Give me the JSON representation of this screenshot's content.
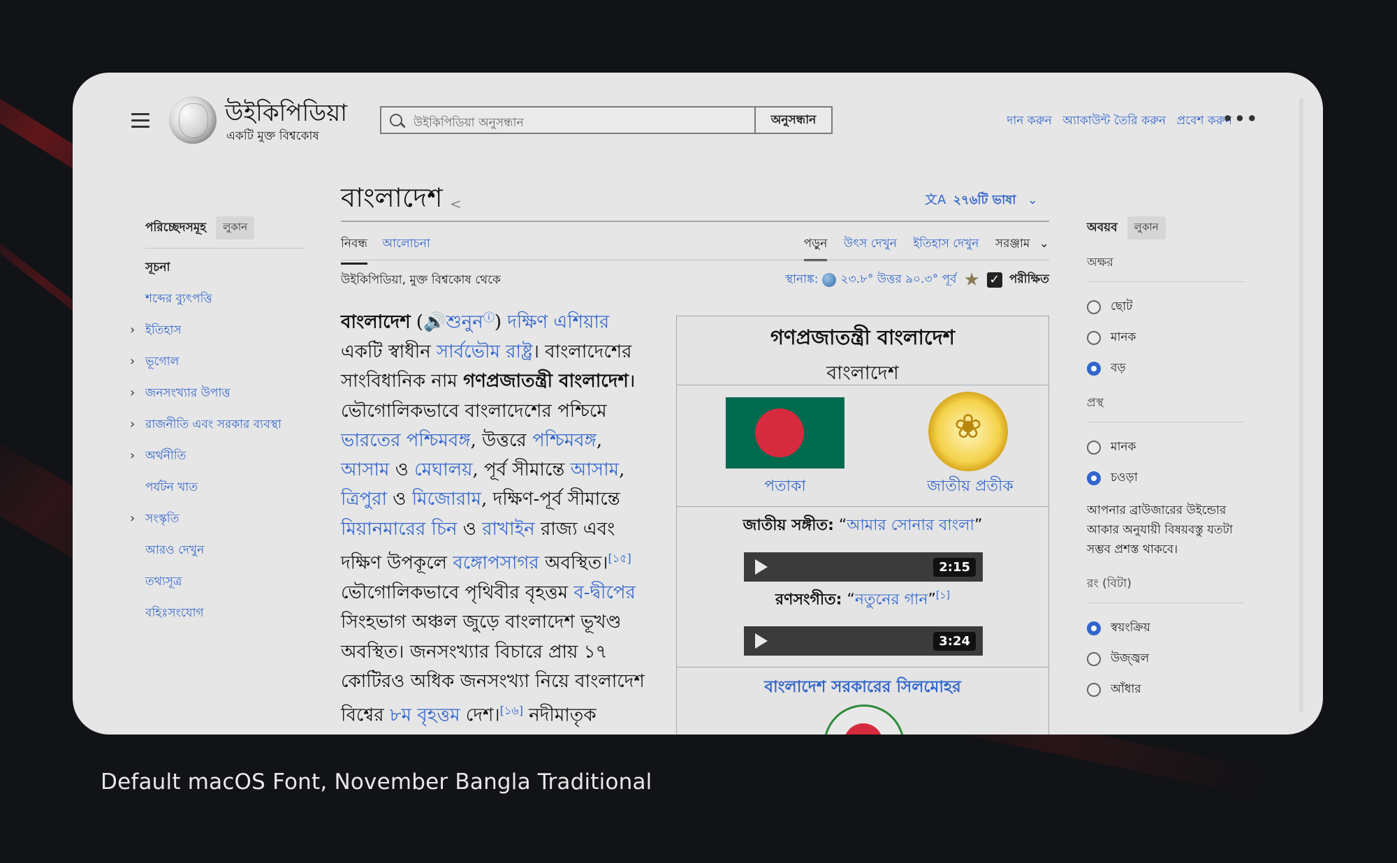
{
  "header": {
    "wordmark": "উইকিপিডিয়া",
    "tagline": "একটি মুক্ত বিশ্বকোষ",
    "search_placeholder": "উইকিপিডিয়া অনুসন্ধান",
    "search_button": "অনুসন্ধান",
    "user_links": [
      "দান করুন",
      "অ্যাকাউন্ট তৈরি করুন",
      "প্রবেশ করুন"
    ]
  },
  "toc": {
    "heading": "পরিচ্ছেদসমূহ",
    "hide_label": "লুকান",
    "items": [
      {
        "label": "সূচনা",
        "expandable": false
      },
      {
        "label": "শব্দের ব্যুৎপত্তি",
        "expandable": false
      },
      {
        "label": "ইতিহাস",
        "expandable": true
      },
      {
        "label": "ভূগোল",
        "expandable": true
      },
      {
        "label": "জনসংখ্যার উপাত্ত",
        "expandable": true
      },
      {
        "label": "রাজনীতি এবং সরকার ব্যবস্থা",
        "expandable": true
      },
      {
        "label": "অর্থনীতি",
        "expandable": true
      },
      {
        "label": "পর্যটন খাত",
        "expandable": false
      },
      {
        "label": "সংস্কৃতি",
        "expandable": true
      },
      {
        "label": "আরও দেখুন",
        "expandable": false
      },
      {
        "label": "তথ্যসূত্র",
        "expandable": false
      },
      {
        "label": "বহিঃসংযোগ",
        "expandable": false
      }
    ]
  },
  "article": {
    "title": "বাংলাদেশ",
    "languages": "২৭৬টি ভাষা",
    "tabs_left": [
      "নিবন্ধ",
      "আলোচনা"
    ],
    "tabs_right": [
      "পড়ুন",
      "উৎস দেখুন",
      "ইতিহাস দেখুন",
      "সরঞ্জাম"
    ],
    "from": "উইকিপিডিয়া, মুক্ত বিশ্বকোষ থেকে",
    "coord_label": "স্থানাঙ্ক:",
    "coord_value": "২৩.৮° উত্তর ৯০.৩° পূর্ব",
    "verified": "পরীক্ষিত",
    "body": {
      "l1_bold": "বাংলাদেশ",
      "l1_paren_open": " (",
      "l1_listen": "🔊শুনুন",
      "l1_info": "ⓘ",
      "l1_paren_close": ") ",
      "l1_link": "দক্ষিণ এশিয়ার",
      "l2_pre": "একটি স্বাধীন ",
      "l2_link": "সার্বভৌম রাষ্ট্র",
      "l2_post": "। বাংলাদেশের",
      "l3_pre": "সাংবিধানিক নাম ",
      "l3_bold": "গণপ্রজাতন্ত্রী বাংলাদেশ",
      "l3_post": "।",
      "l4": "ভৌগোলিকভাবে বাংলাদেশের পশ্চিমে",
      "l5_link1": "ভারতের পশ্চিমবঙ্গ",
      "l5_mid": ", উত্তরে ",
      "l5_link2": "পশ্চিমবঙ্গ",
      "l5_post": ",",
      "l6_link1": "আসাম",
      "l6_mid1": " ও ",
      "l6_link2": "মেঘালয়",
      "l6_mid2": ", পূর্ব সীমান্তে ",
      "l6_link3": "আসাম",
      "l6_post": ",",
      "l7_link1": "ত্রিপুরা",
      "l7_mid": " ও ",
      "l7_link2": "মিজোরাম",
      "l7_post": ", দক্ষিণ-পূর্ব সীমান্তে",
      "l8_link1": "মিয়ানমারের চিন",
      "l8_mid": " ও ",
      "l8_link2": "রাখাইন",
      "l8_post": " রাজ্য এবং",
      "l9_pre": "দক্ষিণ উপকূলে ",
      "l9_link": "বঙ্গোপসাগর",
      "l9_post": " অবস্থিত।",
      "l9_ref": "[১৫]",
      "l10_pre": "ভৌগোলিকভাবে পৃথিবীর বৃহত্তম ",
      "l10_link": "ব-দ্বীপের",
      "l11": "সিংহভাগ অঞ্চল জুড়ে বাংলাদেশ ভূখণ্ড",
      "l12": "অবস্থিত। জনসংখ্যার বিচারে প্রায় ১৭",
      "l13": "কোটিরও অধিক জনসংখ্যা নিয়ে বাংলাদেশ",
      "l14_pre": "বিশ্বের ",
      "l14_link": "৮ম বৃহত্তম",
      "l14_mid": " দেশ।",
      "l14_ref": "[১৬]",
      "l14_post": " নদীমাতৃক"
    }
  },
  "infobox": {
    "title": "গণপ্রজাতন্ত্রী বাংলাদেশ",
    "subtitle": "বাংলাদেশ",
    "flag_label": "পতাকা",
    "emblem_label": "জাতীয় প্রতীক",
    "anthem_label": "জাতীয় সঙ্গীত:",
    "anthem_quote_open": " “",
    "anthem_link": "আমার সোনার বাংলা",
    "anthem_quote_close": "”",
    "anthem_duration": "2:15",
    "march_label": "রণসংগীত:",
    "march_quote_open": " “",
    "march_link": "নতুনের গান",
    "march_quote_close": "”",
    "march_ref": "[১]",
    "march_duration": "3:24",
    "seal_title": "বাংলাদেশ সরকারের সিলমোহর"
  },
  "appearance": {
    "heading": "অবয়ব",
    "hide_label": "লুকান",
    "text_label": "অক্ষর",
    "text_options": [
      "ছোট",
      "মানক",
      "বড়"
    ],
    "text_selected": 2,
    "width_label": "প্রস্থ",
    "width_options": [
      "মানক",
      "চওড়া"
    ],
    "width_selected": 1,
    "width_note": "আপনার ব্রাউজারের উইন্ডোর আকার অনুযায়ী বিষয়বস্তু যতটা সম্ভব প্রশস্ত থাকবে।",
    "color_label": "রং (বিটা)",
    "color_options": [
      "স্বয়ংক্রিয়",
      "উজ্জ্বল",
      "আঁধার"
    ],
    "color_selected": 0
  },
  "caption": "Default macOS Font, November Bangla Traditional",
  "colors": {
    "link": "#3366cc",
    "card_bg": "#e6e6e6",
    "page_bg": "#111316",
    "flag_green": "#006a4e",
    "flag_red": "#d62a3e"
  }
}
